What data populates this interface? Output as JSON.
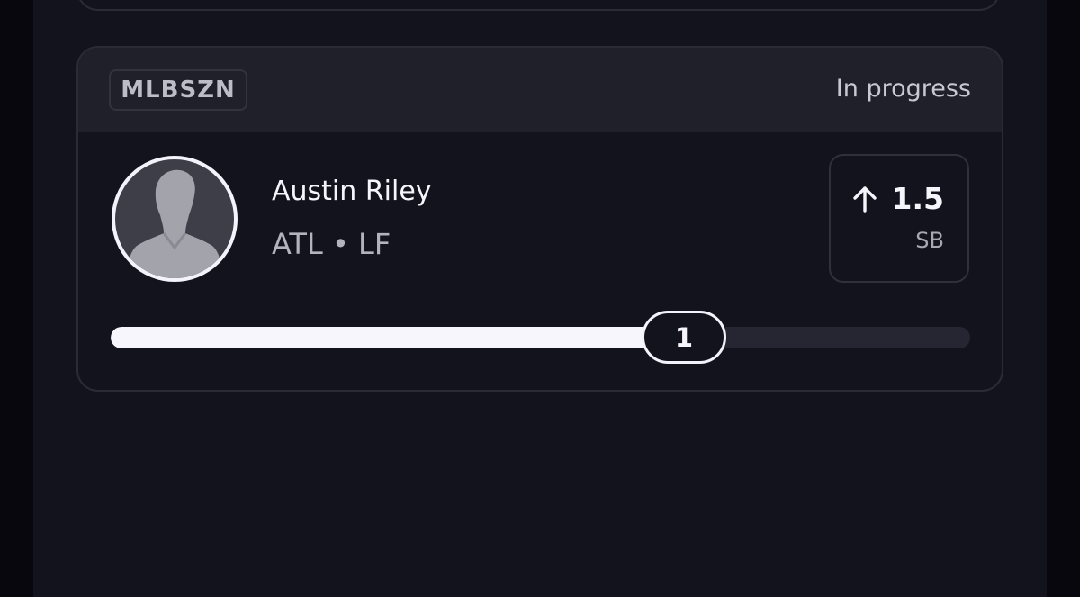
{
  "card": {
    "league": "MLBSZN",
    "status": "In progress",
    "player": {
      "name": "Austin Riley",
      "team_position": "ATL • LF",
      "avatar_icon": "player-silhouette-icon"
    },
    "line": {
      "direction_icon": "arrow-up-icon",
      "value": "1.5",
      "stat": "SB"
    },
    "progress": {
      "current": "1",
      "fraction": 0.65
    }
  },
  "colors": {
    "background": "#13131d",
    "card_header": "#20202b",
    "accent": "#f8f6fd",
    "muted_text": "#b3b3bd"
  }
}
